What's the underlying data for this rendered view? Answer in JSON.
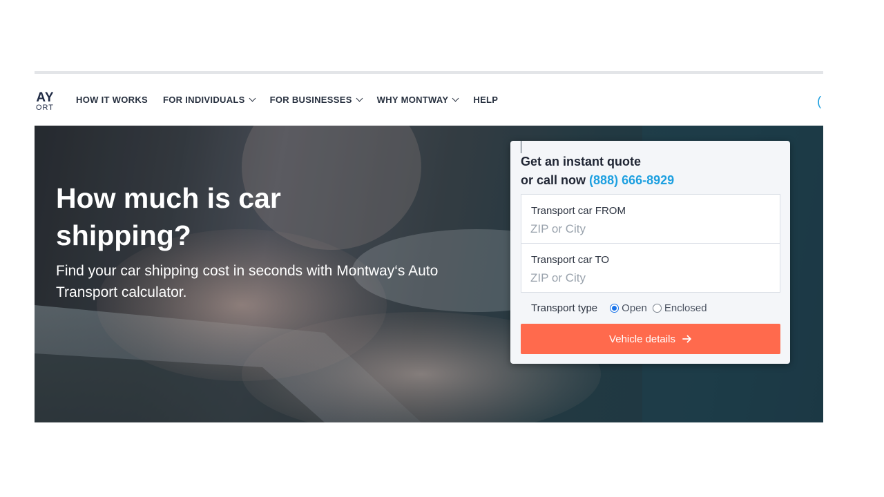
{
  "brand": {
    "logo_main": "AY",
    "logo_sub": "ORT"
  },
  "nav": {
    "items": [
      {
        "label": "HOW IT WORKS",
        "has_dropdown": false
      },
      {
        "label": "FOR INDIVIDUALS",
        "has_dropdown": true
      },
      {
        "label": "FOR BUSINESSES",
        "has_dropdown": true
      },
      {
        "label": "WHY MONTWAY",
        "has_dropdown": true
      },
      {
        "label": "HELP",
        "has_dropdown": false
      }
    ],
    "phone_partial": "("
  },
  "hero": {
    "title": "How much is car shipping?",
    "subtitle": "Find your car shipping cost in seconds with Montway‘s Auto Transport calculator."
  },
  "quote": {
    "title": "Get an instant quote",
    "call_prefix": "or call now",
    "phone": "(888) 666-8929",
    "from_label": "Transport car FROM",
    "from_placeholder": "ZIP or City",
    "to_label": "Transport car TO",
    "to_placeholder": "ZIP or City",
    "type_label": "Transport type",
    "type_options": [
      {
        "label": "Open",
        "selected": true
      },
      {
        "label": "Enclosed",
        "selected": false
      }
    ],
    "cta_label": "Vehicle details"
  },
  "colors": {
    "accent_cta": "#ff6a4d",
    "link_blue": "#1ea0e0",
    "nav_text": "#27303f",
    "radio_selected": "#1a73e8"
  },
  "icons": {
    "dropdown": "chevron-down-icon",
    "cta": "arrow-right-icon"
  }
}
